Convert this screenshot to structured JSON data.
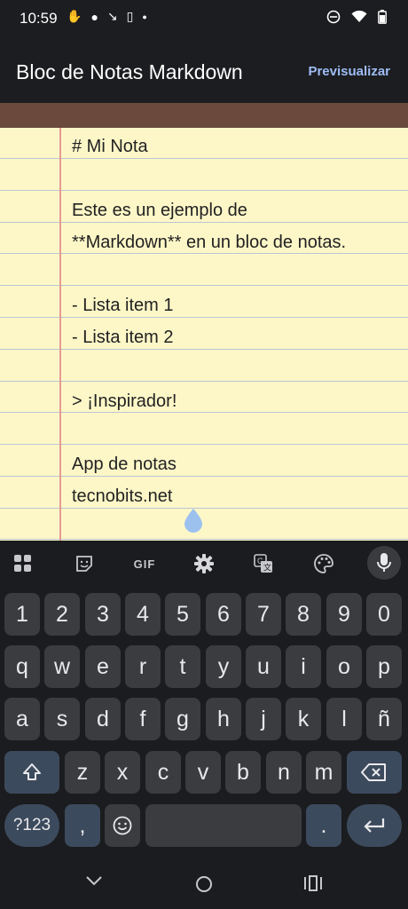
{
  "status_bar": {
    "time": "10:59",
    "icons": [
      "hand-icon",
      "circle-icon",
      "missed-call-icon",
      "sim-icon",
      "dot-icon",
      "dnd-icon",
      "wifi-icon",
      "battery-icon"
    ]
  },
  "app_bar": {
    "title": "Bloc de Notas Markdown",
    "preview_label": "Previsualizar"
  },
  "note": {
    "lines": [
      "# Mi Nota",
      "",
      "Este es un ejemplo de",
      "**Markdown** en un bloc de notas.",
      "",
      "- Lista item 1",
      "- Lista item 2",
      "",
      "> ¡Inspirador!",
      "",
      "App de notas",
      "tecnobits.net"
    ]
  },
  "keyboard": {
    "toolbar": [
      "apps-icon",
      "sticker-icon",
      "gif-label",
      "gear-icon",
      "translate-icon",
      "palette-icon",
      "mic-icon"
    ],
    "gif_label": "GIF",
    "row_numbers": [
      "1",
      "2",
      "3",
      "4",
      "5",
      "6",
      "7",
      "8",
      "9",
      "0"
    ],
    "row1": [
      "q",
      "w",
      "e",
      "r",
      "t",
      "y",
      "u",
      "i",
      "o",
      "p"
    ],
    "row2": [
      "a",
      "s",
      "d",
      "f",
      "g",
      "h",
      "j",
      "k",
      "l",
      "ñ"
    ],
    "row3": [
      "z",
      "x",
      "c",
      "v",
      "b",
      "n",
      "m"
    ],
    "symbols_label": "?123",
    "comma": ",",
    "period": "."
  },
  "colors": {
    "paper": "#fdf7c8",
    "rule": "#b9c6d2",
    "margin": "#e59a93",
    "band": "#6b4a3d",
    "accent": "#9ebcf5"
  }
}
